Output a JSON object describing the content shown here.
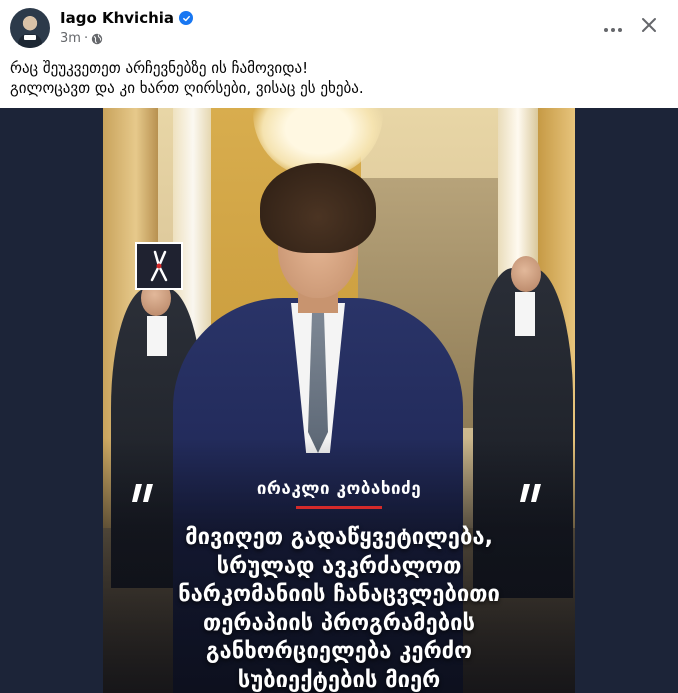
{
  "post": {
    "author": "Iago Khvichia",
    "time": "3m",
    "separator": "·",
    "text_lines": [
      "რაც შეუკვეთეთ არჩევნებზე ის ჩამოვიდა!",
      "გილოცავთ და კი ხართ ღირსები, ვისაც ეს ეხება."
    ]
  },
  "icons": {
    "verified": "verified-badge-icon",
    "audience": "globe-icon",
    "more": "more-horizontal-icon",
    "close": "close-icon"
  },
  "colors": {
    "verified_blue": "#1877f2",
    "meta_gray": "#65676b",
    "media_bg": "#1c2438",
    "accent_red": "#d42a2a"
  },
  "media": {
    "quote_marks": "„„",
    "name": "ირაკლი კობახიძე",
    "quote_lines": [
      "მივიღეთ გადაწყვეტილება,",
      "სრულად ავკრძალოთ",
      "ნარკომანიის ჩანაცვლებითი",
      "თერაპიის პროგრამების",
      "განხორციელება კერძო",
      "სუბიექტების მიერ"
    ]
  }
}
